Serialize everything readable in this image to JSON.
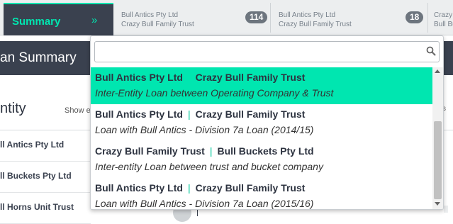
{
  "tabs": {
    "summary_label": "Summary",
    "summary_chevron": "»",
    "items": [
      {
        "line1": "Bull Antics Pty Ltd",
        "line2": "Crazy Bull Family Trust",
        "count": "114"
      },
      {
        "line1": "Bull Antics Pty Ltd",
        "line2": "Crazy Bull Family Trust",
        "count": "18"
      },
      {
        "line1": "Crazy B",
        "line2": "Bull Bu"
      }
    ]
  },
  "page_header": {
    "title": "an Summary"
  },
  "section": {
    "title": "ntity",
    "show_label": "Show e",
    "right_fragment": "s",
    "entities": [
      "ll Antics Pty Ltd",
      "ll Buckets Pty Ltd",
      "ll Horns Unit Trust"
    ]
  },
  "dropdown": {
    "search": {
      "value": "",
      "placeholder": "",
      "icon": "search-icon"
    },
    "options": [
      {
        "left": "Bull Antics Pty Ltd",
        "separator": "|",
        "right": "Crazy Bull Family Trust",
        "description": "Inter-Entity Loan between Operating Company & Trust",
        "selected": true
      },
      {
        "left": "Bull Antics Pty Ltd",
        "separator": "|",
        "right": "Crazy Bull Family Trust",
        "description": "Loan with Bull Antics - Division 7a Loan (2014/15)",
        "selected": false
      },
      {
        "left": "Crazy Bull Family Trust",
        "separator": "|",
        "right": "Bull Buckets Pty Ltd",
        "description": "Inter-entity Loan between trust and bucket company",
        "selected": false
      },
      {
        "left": "Bull Antics Pty Ltd",
        "separator": "|",
        "right": "Crazy Bull Family Trust",
        "description": "Loan with Bull Antics - Division 7a Loan (2015/16)",
        "selected": false
      }
    ]
  },
  "colors": {
    "accent": "#00e6b0",
    "dark": "#3a414f",
    "tab_bg": "#eceeef",
    "badge": "#6d757e"
  }
}
